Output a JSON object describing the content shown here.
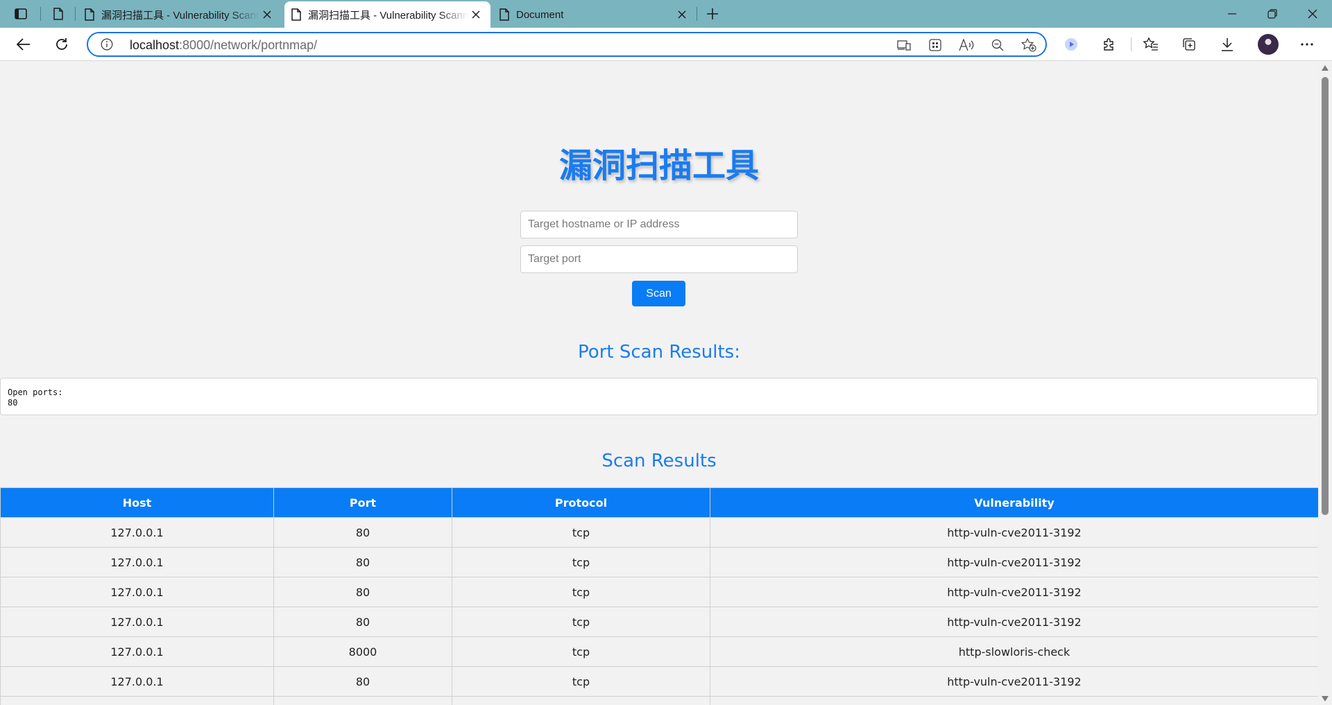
{
  "browser": {
    "tabs": [
      {
        "title": "漏洞扫描工具 - Vulnerability Scanner",
        "active": false
      },
      {
        "title": "漏洞扫描工具 - Vulnerability Scanner",
        "active": true
      },
      {
        "title": "Document",
        "active": false
      }
    ],
    "address": {
      "host": "localhost",
      "rest": ":8000/network/portnmap/"
    }
  },
  "page": {
    "title": "漏洞扫描工具",
    "target_host_placeholder": "Target hostname or IP address",
    "target_port_placeholder": "Target port",
    "scan_label": "Scan",
    "port_results_heading": "Port Scan Results:",
    "port_results_output": "Open ports:\n80",
    "scan_results_heading": "Scan Results"
  },
  "results_table": {
    "columns": [
      "Host",
      "Port",
      "Protocol",
      "Vulnerability"
    ],
    "rows": [
      [
        "127.0.0.1",
        "80",
        "tcp",
        "http-vuln-cve2011-3192"
      ],
      [
        "127.0.0.1",
        "80",
        "tcp",
        "http-vuln-cve2011-3192"
      ],
      [
        "127.0.0.1",
        "80",
        "tcp",
        "http-vuln-cve2011-3192"
      ],
      [
        "127.0.0.1",
        "80",
        "tcp",
        "http-vuln-cve2011-3192"
      ],
      [
        "127.0.0.1",
        "8000",
        "tcp",
        "http-slowloris-check"
      ],
      [
        "127.0.0.1",
        "80",
        "tcp",
        "http-vuln-cve2011-3192"
      ]
    ]
  },
  "colors": {
    "accent": "#0a7cf5",
    "titlebar": "#7ab4bf"
  }
}
